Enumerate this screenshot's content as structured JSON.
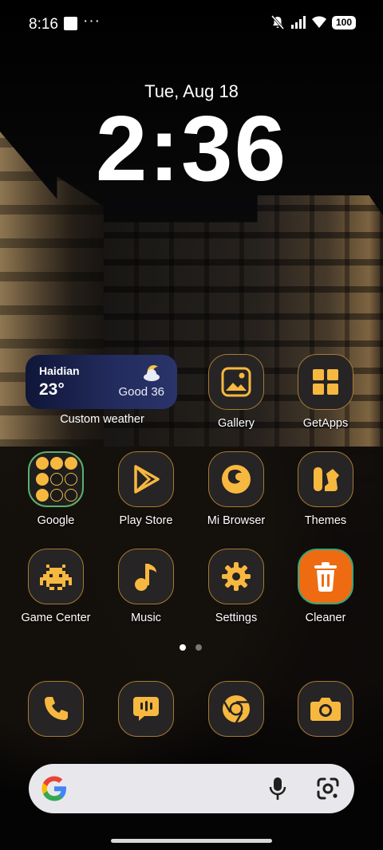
{
  "status_bar": {
    "time": "8:16",
    "more": "···",
    "battery": "100",
    "icons": [
      "notification-square-icon",
      "vibrate-mute-icon",
      "signal-icon",
      "wifi-icon",
      "battery-icon"
    ]
  },
  "lock": {
    "date": "Tue, Aug 18",
    "clock": "2:36"
  },
  "weather": {
    "city": "Haidian",
    "temp": "23°",
    "aqi": "Good 36",
    "label": "Custom weather",
    "icon": "partly-cloudy-night-icon"
  },
  "apps": {
    "gallery": "Gallery",
    "getapps": "GetApps",
    "google": "Google",
    "playstore": "Play Store",
    "browser": "Mi Browser",
    "themes": "Themes",
    "gamecenter": "Game Center",
    "music": "Music",
    "settings": "Settings",
    "cleaner": "Cleaner"
  },
  "dock": [
    "phone-icon",
    "messages-icon",
    "chrome-icon",
    "camera-icon"
  ],
  "pager": {
    "count": 2,
    "active": 1
  },
  "colors": {
    "icon_accent": "#F7B840",
    "tile_bg": "#262424",
    "tile_border": "#A77B32",
    "cleaner_bg": "#EF6B12",
    "search_bg": "#E8E8EC"
  }
}
